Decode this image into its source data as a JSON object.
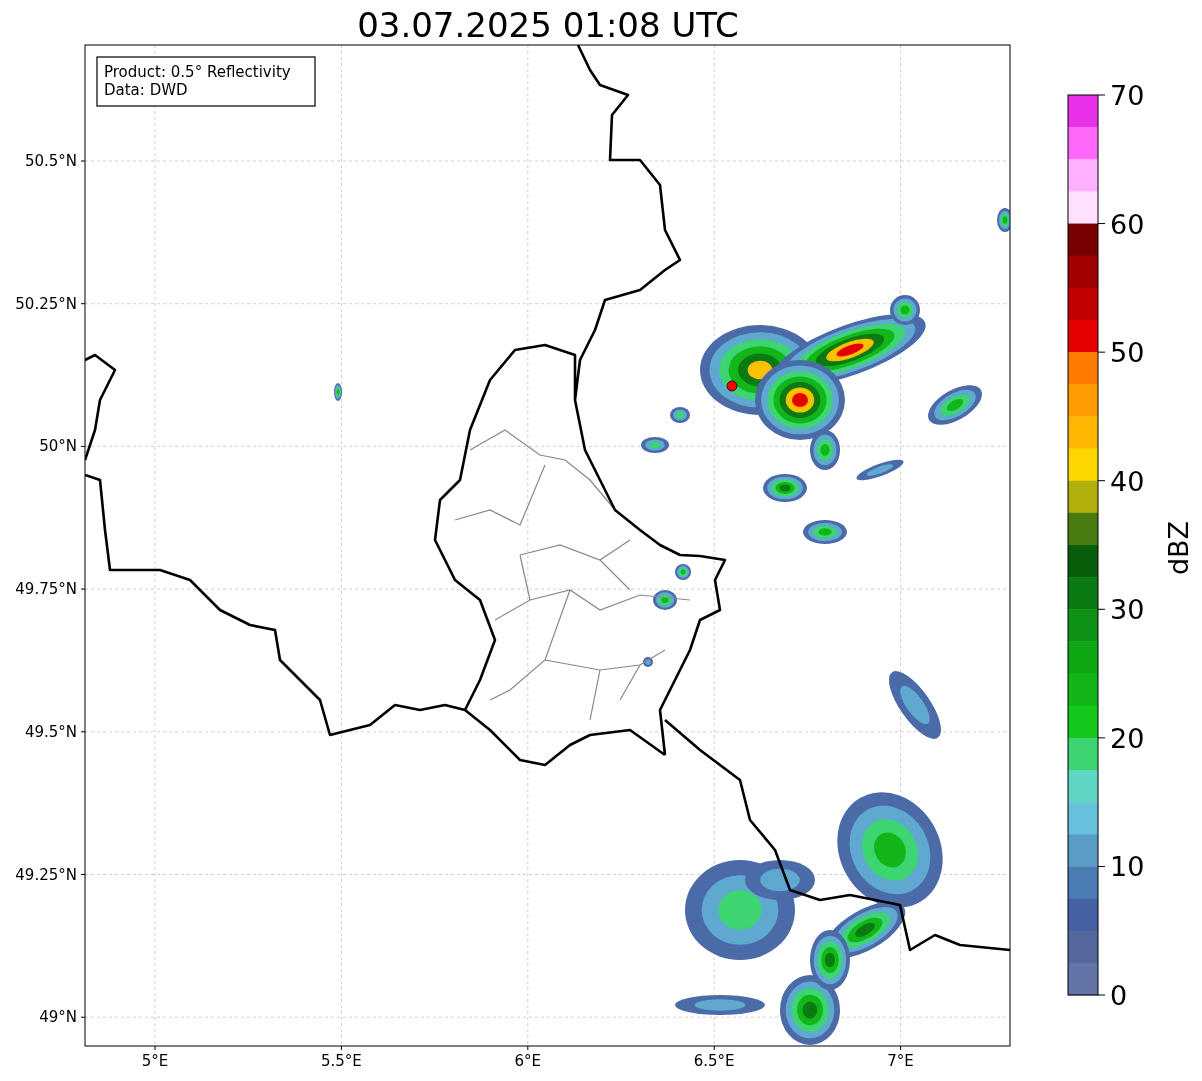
{
  "title": "03.07.2025 01:08 UTC",
  "legend": [
    "Product: 0.5° Reflectivity",
    "Data: DWD"
  ],
  "map": {
    "y_ticks": [
      "50.5°N",
      "50.25°N",
      "50°N",
      "49.75°N",
      "49.5°N",
      "49.25°N",
      "49°N"
    ],
    "x_ticks": [
      "5°E",
      "5.5°E",
      "6°E",
      "6.5°E",
      "7°E"
    ]
  },
  "colorbar": {
    "label": "dBZ",
    "ticks": [
      "70",
      "60",
      "50",
      "40",
      "30",
      "20",
      "10",
      "0"
    ],
    "segments": [
      {
        "color": "#e830e8"
      },
      {
        "color": "#ff68f8"
      },
      {
        "color": "#ffb0ff"
      },
      {
        "color": "#ffe0ff"
      },
      {
        "color": "#780000"
      },
      {
        "color": "#a00000"
      },
      {
        "color": "#c00000"
      },
      {
        "color": "#e40000"
      },
      {
        "color": "#ff7c00"
      },
      {
        "color": "#ff9c00"
      },
      {
        "color": "#ffb600"
      },
      {
        "color": "#ffd700"
      },
      {
        "color": "#b0b00c"
      },
      {
        "color": "#4a7a12"
      },
      {
        "color": "#095e0c"
      },
      {
        "color": "#0b7a12"
      },
      {
        "color": "#0e9213"
      },
      {
        "color": "#10a714"
      },
      {
        "color": "#13b618"
      },
      {
        "color": "#12c81a"
      },
      {
        "color": "#3dd472"
      },
      {
        "color": "#5fd6c1"
      },
      {
        "color": "#67c0dc"
      },
      {
        "color": "#5a9dc4"
      },
      {
        "color": "#4b7cb4"
      },
      {
        "color": "#4561a4"
      },
      {
        "color": "#55689e"
      },
      {
        "color": "#6474a6"
      }
    ]
  }
}
